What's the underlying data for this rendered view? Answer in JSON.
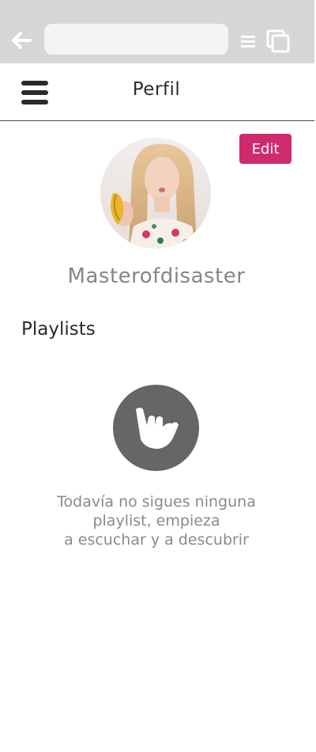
{
  "browser": {
    "url_value": "",
    "icons": {
      "back": "arrow-left-icon",
      "menu": "menu-lines-icon",
      "tabs": "tabs-icon"
    }
  },
  "header": {
    "title": "Perfil",
    "menu_icon": "hamburger-icon"
  },
  "profile": {
    "edit_label": "Edit",
    "username": "Masterofdisaster"
  },
  "playlists": {
    "heading": "Playlists",
    "empty_icon": "shaka-hand-icon",
    "empty_message_lines": [
      "Todavía no sigues ninguna",
      "playlist, empieza",
      "a escuchar y a descubrir"
    ]
  },
  "colors": {
    "accent": "#cf2a6e",
    "browser_bar": "#d6d6d6",
    "icon_circle": "#666666",
    "muted_text": "#8a8a8a"
  }
}
